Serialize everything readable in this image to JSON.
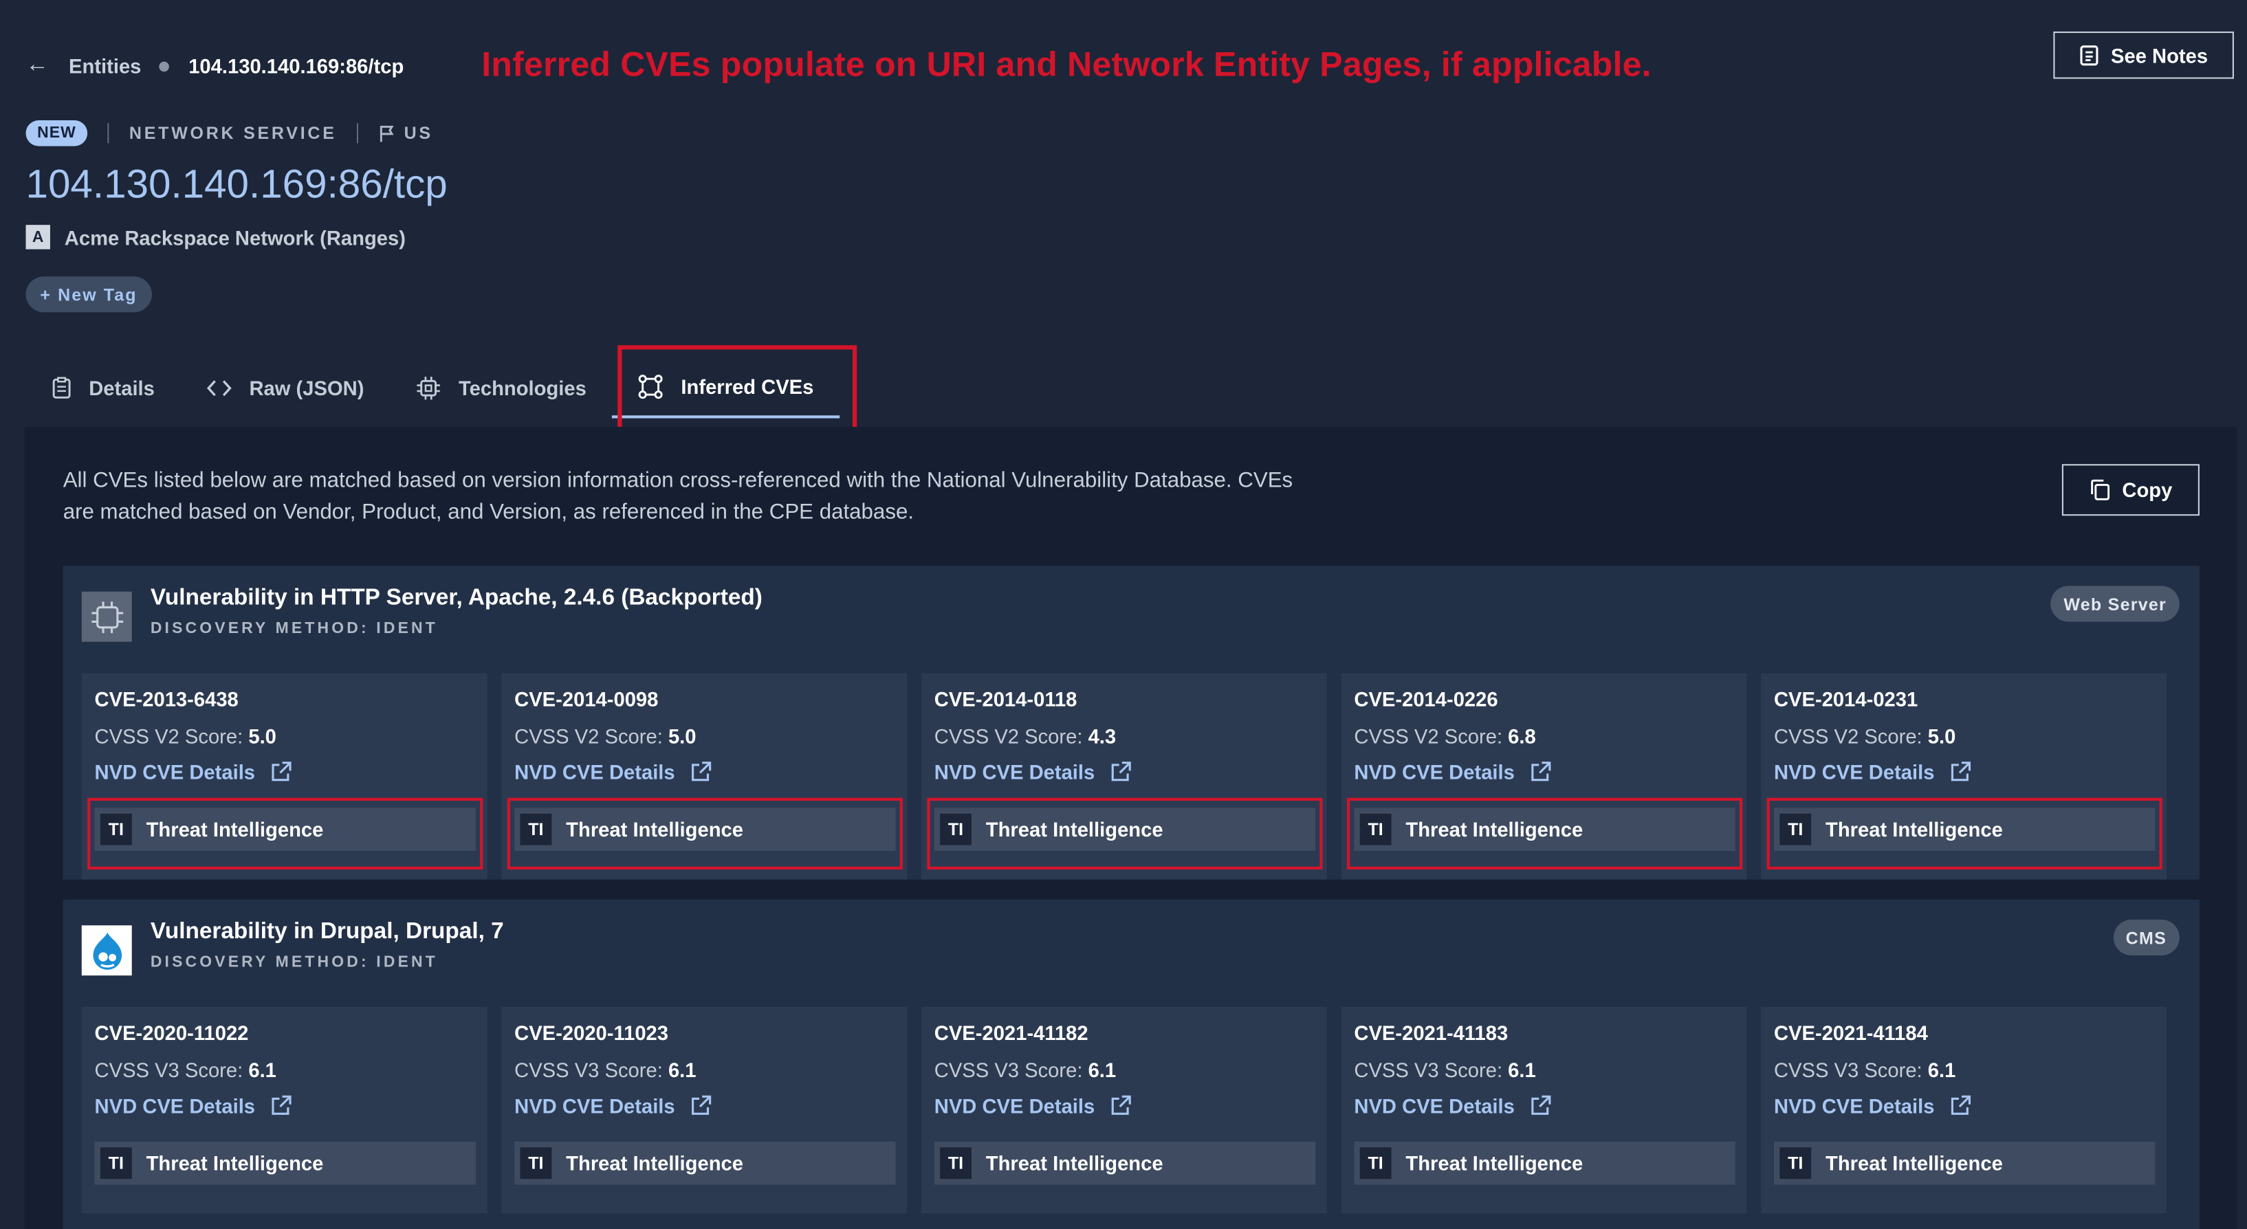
{
  "breadcrumb": {
    "back": "←",
    "root": "Entities",
    "current": "104.130.140.169:86/tcp"
  },
  "annotation": "Inferred CVEs  populate on URI and Network Entity Pages, if applicable.",
  "header": {
    "see_notes": "See Notes",
    "badge": "NEW",
    "type": "NETWORK SERVICE",
    "country": "US",
    "title": "104.130.140.169:86/tcp",
    "org_initial": "A",
    "org": "Acme Rackspace Network (Ranges)",
    "new_tag": "+ New Tag"
  },
  "tabs": [
    {
      "label": "Details",
      "icon": "document-icon"
    },
    {
      "label": "Raw (JSON)",
      "icon": "code-icon"
    },
    {
      "label": "Technologies",
      "icon": "chip-icon"
    },
    {
      "label": "Inferred CVEs",
      "icon": "network-nodes-icon",
      "active": true
    }
  ],
  "panel": {
    "description": "All CVEs listed below are matched based on version information cross-referenced with the National Vulnerability Database. CVEs are matched based on Vendor, Product, and Version, as referenced in the CPE database.",
    "copy": "Copy"
  },
  "groups": [
    {
      "title": "Vulnerability in HTTP Server, Apache, 2.4.6 (Backported)",
      "method": "DISCOVERY METHOD: IDENT",
      "badge": "Web Server",
      "icon": "chip-icon",
      "cves": [
        {
          "id": "CVE-2013-6438",
          "score_label": "CVSS V2 Score:",
          "score": "5.0",
          "link": "NVD CVE Details",
          "ti": "Threat Intelligence",
          "ti_badge": "TI"
        },
        {
          "id": "CVE-2014-0098",
          "score_label": "CVSS V2 Score:",
          "score": "5.0",
          "link": "NVD CVE Details",
          "ti": "Threat Intelligence",
          "ti_badge": "TI"
        },
        {
          "id": "CVE-2014-0118",
          "score_label": "CVSS V2 Score:",
          "score": "4.3",
          "link": "NVD CVE Details",
          "ti": "Threat Intelligence",
          "ti_badge": "TI"
        },
        {
          "id": "CVE-2014-0226",
          "score_label": "CVSS V2 Score:",
          "score": "6.8",
          "link": "NVD CVE Details",
          "ti": "Threat Intelligence",
          "ti_badge": "TI"
        },
        {
          "id": "CVE-2014-0231",
          "score_label": "CVSS V2 Score:",
          "score": "5.0",
          "link": "NVD CVE Details",
          "ti": "Threat Intelligence",
          "ti_badge": "TI"
        }
      ]
    },
    {
      "title": "Vulnerability in Drupal, Drupal, 7",
      "method": "DISCOVERY METHOD: IDENT",
      "badge": "CMS",
      "icon": "drupal-logo-icon",
      "cves": [
        {
          "id": "CVE-2020-11022",
          "score_label": "CVSS V3 Score:",
          "score": "6.1",
          "link": "NVD CVE Details",
          "ti": "Threat Intelligence",
          "ti_badge": "TI"
        },
        {
          "id": "CVE-2020-11023",
          "score_label": "CVSS V3 Score:",
          "score": "6.1",
          "link": "NVD CVE Details",
          "ti": "Threat Intelligence",
          "ti_badge": "TI"
        },
        {
          "id": "CVE-2021-41182",
          "score_label": "CVSS V3 Score:",
          "score": "6.1",
          "link": "NVD CVE Details",
          "ti": "Threat Intelligence",
          "ti_badge": "TI"
        },
        {
          "id": "CVE-2021-41183",
          "score_label": "CVSS V3 Score:",
          "score": "6.1",
          "link": "NVD CVE Details",
          "ti": "Threat Intelligence",
          "ti_badge": "TI"
        },
        {
          "id": "CVE-2021-41184",
          "score_label": "CVSS V3 Score:",
          "score": "6.1",
          "link": "NVD CVE Details",
          "ti": "Threat Intelligence",
          "ti_badge": "TI"
        }
      ]
    }
  ]
}
